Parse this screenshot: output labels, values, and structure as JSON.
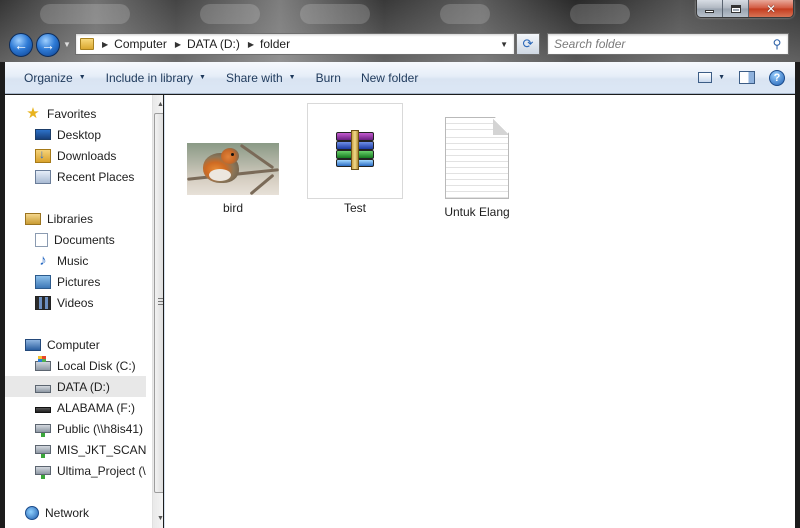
{
  "address": {
    "crumbs": [
      "Computer",
      "DATA (D:)",
      "folder"
    ]
  },
  "search": {
    "placeholder": "Search folder"
  },
  "toolbar": {
    "organize": "Organize",
    "include_in_library": "Include in library",
    "share_with": "Share with",
    "burn": "Burn",
    "new_folder": "New folder"
  },
  "sidebar": {
    "favorites": {
      "header": "Favorites",
      "items": [
        "Desktop",
        "Downloads",
        "Recent Places"
      ]
    },
    "libraries": {
      "header": "Libraries",
      "items": [
        "Documents",
        "Music",
        "Pictures",
        "Videos"
      ]
    },
    "computer": {
      "header": "Computer",
      "items": [
        "Local Disk (C:)",
        "DATA (D:)",
        "ALABAMA (F:)",
        "Public (\\\\h8is41)",
        "MIS_JKT_SCAN$",
        "Ultima_Project (\\"
      ],
      "selected": "DATA (D:)"
    },
    "network": {
      "header": "Network"
    }
  },
  "files": [
    {
      "name": "bird",
      "icon": "image-thumbnail"
    },
    {
      "name": "Test",
      "icon": "winrar-archive-icon"
    },
    {
      "name": "Untuk Elang",
      "icon": "text-document-icon"
    }
  ]
}
